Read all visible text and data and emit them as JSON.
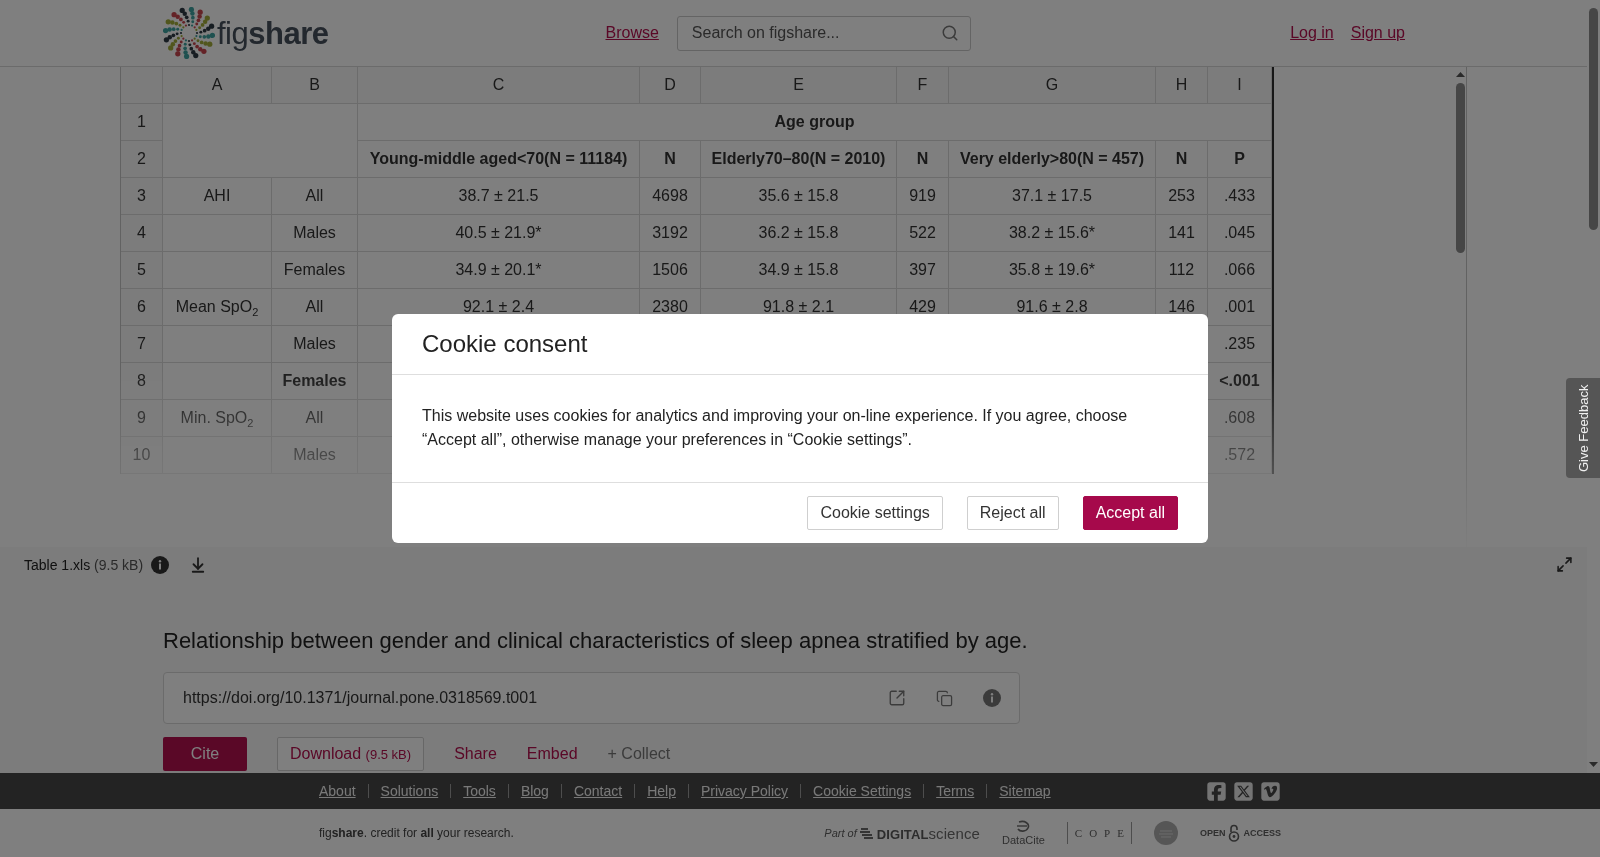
{
  "header": {
    "logo": {
      "light": "fig",
      "bold": "share"
    },
    "nav_link": "Browse",
    "search": {
      "placeholder": "Search on figshare..."
    },
    "auth_links": [
      "Log in",
      "Sign up"
    ]
  },
  "spreadsheet": {
    "columns": [
      "A",
      "B",
      "C",
      "D",
      "E",
      "F",
      "G",
      "H",
      "I"
    ],
    "header_band": {
      "row_numbers": [
        "1",
        "2"
      ],
      "group_label": "Age group",
      "subheaders": [
        "Young-middle aged<70(N = 11184)",
        "N",
        "Elderly70–80(N = 2010)",
        "N",
        "Very elderly>80(N = 457)",
        "N",
        "P"
      ]
    },
    "rows": [
      {
        "number": "3",
        "cells": [
          {
            "text": "AHI",
            "bold": false
          },
          {
            "text": "All",
            "bold": false
          },
          {
            "text": "38.7 ± 21.5",
            "bold": false
          },
          {
            "text": "4698",
            "bold": false
          },
          {
            "text": "35.6 ± 15.8",
            "bold": false
          },
          {
            "text": "919",
            "bold": false
          },
          {
            "text": "37.1 ± 17.5",
            "bold": false
          },
          {
            "text": "253",
            "bold": false
          },
          {
            "text": ".433",
            "bold": false
          }
        ]
      },
      {
        "number": "4",
        "cells": [
          null,
          {
            "text": "Males",
            "bold": false
          },
          {
            "text": "40.5 ± 21.9*",
            "bold": false
          },
          {
            "text": "3192",
            "bold": false
          },
          {
            "text": "36.2 ± 15.8",
            "bold": false
          },
          {
            "text": "522",
            "bold": false
          },
          {
            "text": "38.2 ± 15.6*",
            "bold": false
          },
          {
            "text": "141",
            "bold": false
          },
          {
            "text": ".045",
            "bold": false
          }
        ]
      },
      {
        "number": "5",
        "cells": [
          null,
          {
            "text": "Females",
            "bold": false
          },
          {
            "text": "34.9 ± 20.1*",
            "bold": false
          },
          {
            "text": "1506",
            "bold": false
          },
          {
            "text": "34.9 ± 15.8",
            "bold": false
          },
          {
            "text": "397",
            "bold": false
          },
          {
            "text": "35.8 ± 19.6*",
            "bold": false
          },
          {
            "text": "112",
            "bold": false
          },
          {
            "text": ".066",
            "bold": false
          }
        ]
      },
      {
        "number": "6",
        "cells": [
          {
            "text": "Mean SpO$_{2}$",
            "bold": false
          },
          {
            "text": "All",
            "bold": false
          },
          {
            "text": "92.1 ± 2.4",
            "bold": false
          },
          {
            "text": "2380",
            "bold": false
          },
          {
            "text": "91.8 ± 2.1",
            "bold": false
          },
          {
            "text": "429",
            "bold": false
          },
          {
            "text": "91.6 ± 2.8",
            "bold": false
          },
          {
            "text": "146",
            "bold": false
          },
          {
            "text": ".001",
            "bold": false
          }
        ]
      },
      {
        "number": "7",
        "cells": [
          null,
          {
            "text": "Males",
            "bold": false
          },
          null,
          null,
          null,
          null,
          null,
          null,
          {
            "text": ".235",
            "bold": false
          }
        ]
      },
      {
        "number": "8",
        "cells": [
          null,
          {
            "text": "Females",
            "bold": true
          },
          null,
          null,
          null,
          null,
          null,
          null,
          {
            "text": "<.001",
            "bold": true
          }
        ]
      },
      {
        "number": "9",
        "cells": [
          {
            "text": "Min. SpO$_{2}$",
            "bold": false
          },
          {
            "text": "All",
            "bold": false
          },
          null,
          null,
          null,
          null,
          null,
          null,
          {
            "text": ".608",
            "bold": false
          }
        ]
      },
      {
        "number": "10",
        "cells": [
          null,
          {
            "text": "Males",
            "bold": false
          },
          null,
          null,
          null,
          null,
          null,
          null,
          {
            "text": ".572",
            "bold": false
          }
        ]
      }
    ]
  },
  "file": {
    "name": "Table 1.xls",
    "size": "(9.5 kB)"
  },
  "item": {
    "title": "Relationship between gender and clinical characteristics of sleep apnea stratified by age.",
    "doi": "https://doi.org/10.1371/journal.pone.0318569.t001",
    "actions": [
      {
        "kind": "primary",
        "label": "Cite"
      },
      {
        "kind": "outline",
        "label": "Download",
        "size": "(9.5 kB)"
      },
      {
        "kind": "link",
        "label": "Share"
      },
      {
        "kind": "link",
        "label": "Embed"
      },
      {
        "kind": "muted",
        "label": "+ Collect"
      }
    ]
  },
  "footer": {
    "links": [
      "About",
      "Solutions",
      "Tools",
      "Blog",
      "Contact",
      "Help",
      "Privacy Policy",
      "Cookie Settings",
      "Terms",
      "Sitemap"
    ],
    "tagline": "fig**share**. credit for **all** your research.",
    "partners": [
      {
        "kind": "digital-science",
        "prefix": "Part of",
        "name": "**DIGITAL**science"
      },
      {
        "kind": "datacite",
        "name": "DataCite"
      },
      {
        "kind": "cope",
        "name": "COPE"
      },
      {
        "kind": "seal"
      },
      {
        "kind": "open-access",
        "left": "OPEN",
        "right": "ACCESS"
      }
    ]
  },
  "cookie_dialog": {
    "title": "Cookie consent",
    "message": "This website uses cookies for analytics and improving your on-line experience. If you agree, choose “Accept all”, otherwise manage your preferences in “Cookie settings”.",
    "buttons": [
      {
        "kind": "secondary",
        "label": "Cookie settings"
      },
      {
        "kind": "secondary",
        "label": "Reject all"
      },
      {
        "kind": "primary",
        "label": "Accept all"
      }
    ]
  },
  "feedback_tab": {
    "label": "Give Feedback"
  }
}
